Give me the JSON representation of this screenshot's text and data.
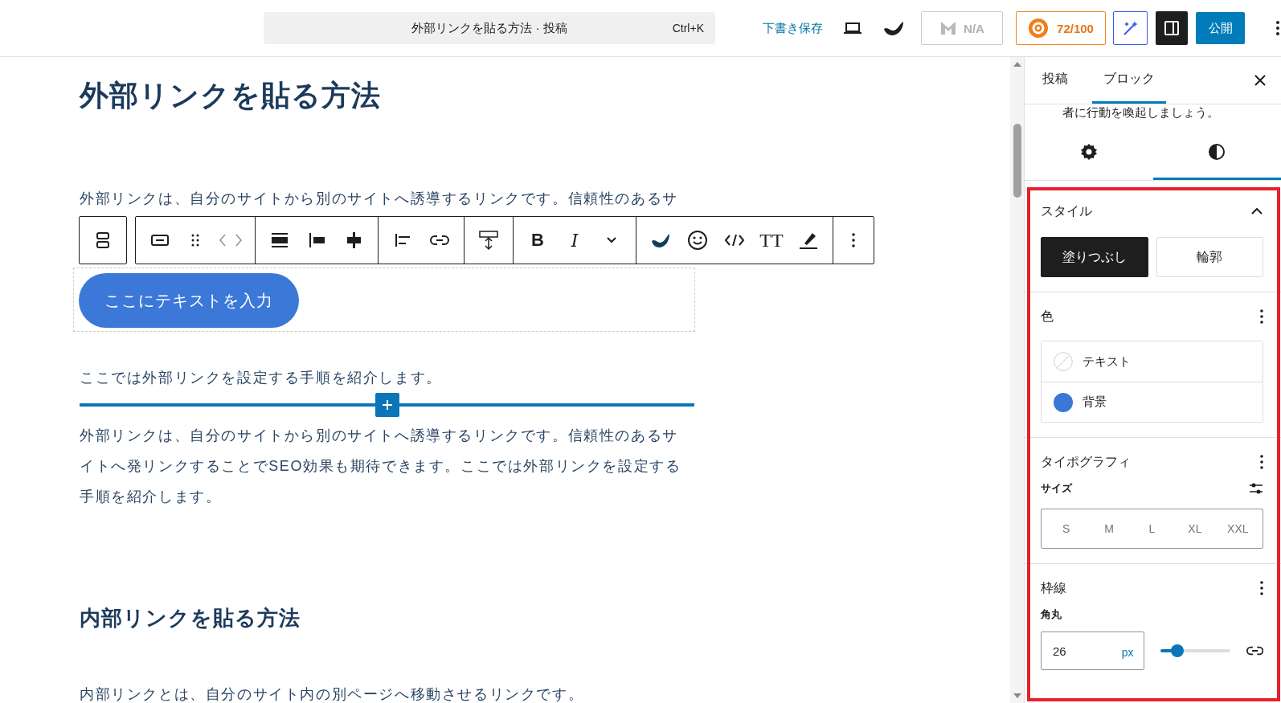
{
  "top_bar": {
    "document_title": "外部リンクを貼る方法 · 投稿",
    "shortcut": "Ctrl+K",
    "save_draft": "下書き保存",
    "seo_status": "N/A",
    "score": "72/100",
    "sidebar_toggle": {
      "selected": true
    },
    "publish": "公開"
  },
  "editor": {
    "title": "外部リンクを貼る方法",
    "paragraph_1": "外部リンクは、自分のサイトから別のサイトへ誘導するリンクです。信頼性のあるサ",
    "button_label": "ここにテキストを入力",
    "paragraph_2": "ここでは外部リンクを設定する手順を紹介します。",
    "paragraph_3": "外部リンクは、自分のサイトから別のサイトへ誘導するリンクです。信頼性のあるサイトへ発リンクすることでSEO効果も期待できます。ここでは外部リンクを設定する手順を紹介します。",
    "heading_2": "内部リンクを貼る方法",
    "paragraph_4": "内部リンクとは、自分のサイト内の別ページへ移動させるリンクです。"
  },
  "block_toolbar": {
    "bold": "B",
    "italic": "I",
    "text_size": "TT"
  },
  "sidebar": {
    "tabs": [
      {
        "label": "投稿",
        "selected": false
      },
      {
        "label": "ブロック",
        "selected": true
      }
    ],
    "cut_text": "者に行動を喚起しましょう。",
    "panel_tabs": [
      {
        "kind": "settings",
        "selected": false
      },
      {
        "kind": "styles",
        "selected": true
      }
    ],
    "style": {
      "title": "スタイル",
      "expanded": true,
      "options": [
        {
          "label": "塗りつぶし",
          "selected": true
        },
        {
          "label": "輪郭",
          "selected": false
        }
      ]
    },
    "color": {
      "title": "色",
      "items": [
        {
          "label": "テキスト",
          "set": false
        },
        {
          "label": "背景",
          "set": true,
          "color": "#3a77d6"
        }
      ]
    },
    "typography": {
      "title": "タイポグラフィ",
      "size_label": "サイズ",
      "sizes": [
        {
          "label": "S",
          "selected": false
        },
        {
          "label": "M",
          "selected": false
        },
        {
          "label": "L",
          "selected": false
        },
        {
          "label": "XL",
          "selected": false
        },
        {
          "label": "XXL",
          "selected": false
        }
      ]
    },
    "border": {
      "title": "枠線",
      "radius_label": "角丸",
      "radius_value": "26",
      "unit": "px",
      "level": 0.25
    }
  }
}
